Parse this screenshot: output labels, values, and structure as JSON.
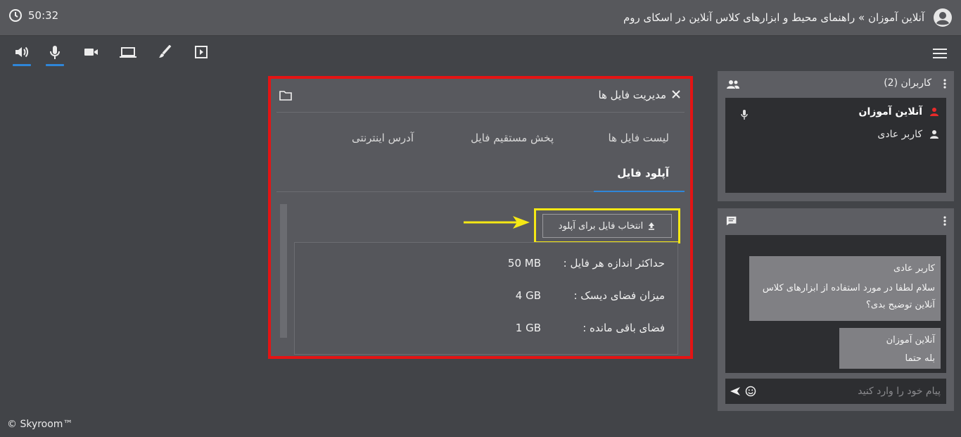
{
  "header": {
    "timer": "50:32",
    "title": "آنلاین آموزان » راهنمای محیط و ابزارهای کلاس آنلاین در اسکای روم"
  },
  "toolbar": {
    "tools": [
      "speaker-icon",
      "mic-icon",
      "camera-icon",
      "screen-share-icon",
      "whiteboard-brush-icon",
      "media-play-icon"
    ],
    "active": [
      "speaker-icon",
      "mic-icon"
    ],
    "menu": "hamburger-menu-icon"
  },
  "file_manager": {
    "title": "مدیریت فایل ها",
    "tabs": [
      {
        "label": "لیست فایل ها"
      },
      {
        "label": "پخش مستقیم فایل"
      },
      {
        "label": "آدرس اینترنتی"
      },
      {
        "label": "آپلود فایل",
        "active": true
      }
    ],
    "upload_button": "انتخاب فایل برای آپلود",
    "info": [
      {
        "label": "حداکثر اندازه هر فایل :",
        "value": "50 MB"
      },
      {
        "label": "میزان فضای دیسک :",
        "value": "4 GB"
      },
      {
        "label": "فضای باقی مانده :",
        "value": "1 GB"
      }
    ]
  },
  "users_panel": {
    "title": "کاربران (2)",
    "users": [
      {
        "name": "آنلاین آموزان",
        "role": "host"
      },
      {
        "name": "کاربر عادی",
        "role": "user"
      }
    ]
  },
  "chat_panel": {
    "messages": [
      {
        "sender": "کاربر عادی",
        "text": "سلام لطفا در مورد استفاده از ابزارهای کلاس آنلاین توضیح بدی؟"
      },
      {
        "sender": "آنلاین آموزان",
        "text": "بله حتما"
      }
    ],
    "input_placeholder": "پیام خود را وارد کنید"
  },
  "colors": {
    "highlight_red": "#e41414",
    "highlight_yellow": "#f5e815",
    "accent_blue": "#2f86d8",
    "host_red": "#e82a2a"
  },
  "footer": "© Skyroom™"
}
